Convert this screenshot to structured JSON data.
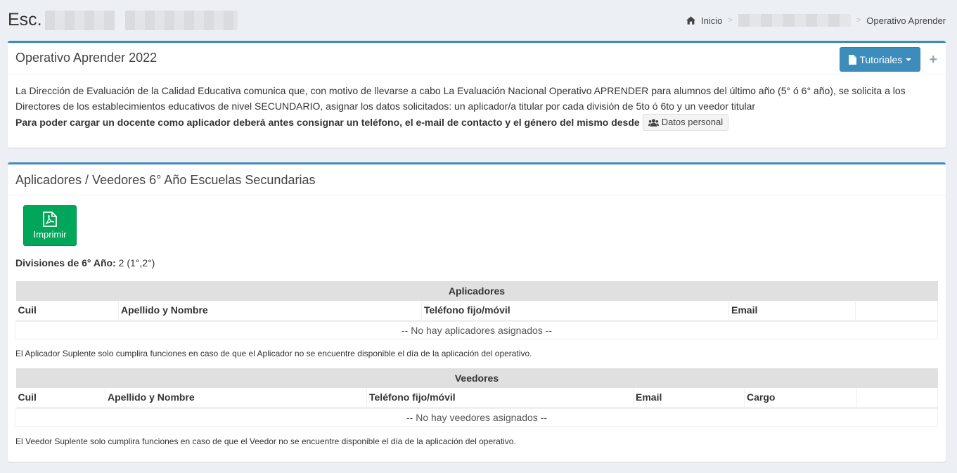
{
  "header": {
    "title_prefix": "Esc.",
    "breadcrumb": {
      "home": "Inicio",
      "current": "Operativo Aprender"
    }
  },
  "box1": {
    "title": "Operativo Aprender 2022",
    "tutoriales_label": "Tutoriales",
    "plus_label": "+",
    "paragraph": "La Dirección de Evaluación de la Calidad Educativa comunica que, con motivo de llevarse a cabo La Evaluación Nacional Operativo APRENDER para alumnos del último año (5° ó 6° año), se solicita a los Directores de los establecimientos educativos de nivel SECUNDARIO, asignar los datos solicitados: un aplicador/a titular por cada división de 5to ó 6to y un veedor titular",
    "bold_text": "Para poder cargar un docente como aplicador deberá antes consignar un teléfono, el e-mail de contacto y el género del mismo desde",
    "datos_label": "Datos personal"
  },
  "box2": {
    "title": "Aplicadores / Veedores 6° Año Escuelas Secundarias",
    "imprimir_label": "Imprimir",
    "divisiones_label": "Divisiones de 6° Año:",
    "divisiones_value": "2 (1°,2°)",
    "aplicadores": {
      "caption": "Aplicadores",
      "columns": [
        "Cuil",
        "Apellido y Nombre",
        "Teléfono fijo/móvil",
        "Email",
        ""
      ],
      "empty": "-- No hay aplicadores asignados --",
      "note": "El Aplicador Suplente solo cumplira funciones en caso de que el Aplicador no se encuentre disponible el día de la aplicación del operativo."
    },
    "veedores": {
      "caption": "Veedores",
      "columns": [
        "Cuil",
        "Apellido y Nombre",
        "Teléfono fijo/móvil",
        "Email",
        "Cargo",
        ""
      ],
      "empty": "-- No hay veedores asignados --",
      "note": "El Veedor Suplente solo cumplira funciones en caso de que el Veedor no se encuentre disponible el día de la aplicación del operativo."
    }
  },
  "colors": {
    "primary": "#3c8dbc",
    "success": "#00a65a",
    "background": "#ecf0f5"
  }
}
